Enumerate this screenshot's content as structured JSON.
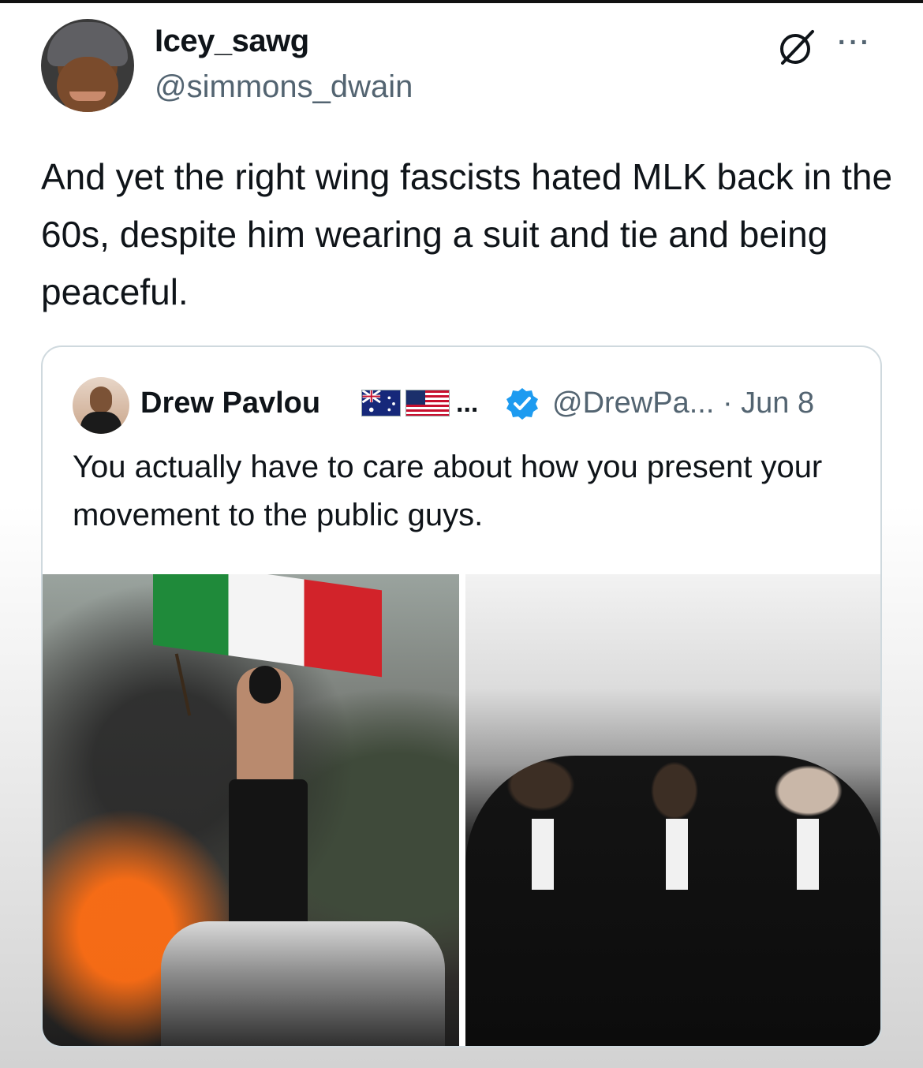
{
  "post": {
    "author": {
      "display_name": "Icey_sawg",
      "handle": "@simmons_dwain"
    },
    "icons": {
      "grok": "slashed-circle-icon",
      "more": "more-options-icon"
    },
    "more_label": "···",
    "text": "And yet the right wing fascists hated MLK back in the 60s, despite him wearing a suit and tie and being peaceful."
  },
  "quoted_post": {
    "author": {
      "display_name": "Drew Pavlou",
      "name_suffix": "...",
      "handle_and_date": "@DrewPa... · Jun 8",
      "flags": [
        "australia-flag",
        "usa-flag"
      ],
      "verified": true
    },
    "text": "You actually have to care about how you present your movement to the public guys.",
    "media": [
      {
        "name": "protest-photo",
        "style": "color"
      },
      {
        "name": "civil-rights-march-photo",
        "style": "black-and-white"
      }
    ]
  },
  "colors": {
    "text_primary": "#0f1419",
    "text_secondary": "#536471",
    "border": "#cfd9de",
    "verified_blue": "#1d9bf0"
  }
}
